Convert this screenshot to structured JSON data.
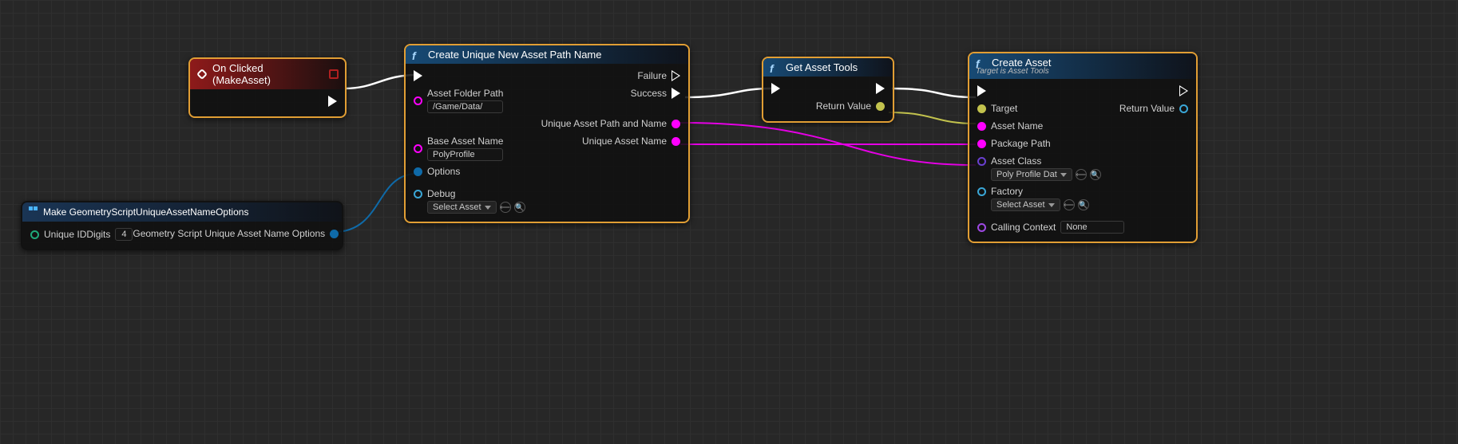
{
  "nodes": {
    "onClicked": {
      "title": "On Clicked (MakeAsset)"
    },
    "makeOpts": {
      "title": "Make GeometryScriptUniqueAssetNameOptions",
      "inputs": {
        "uniqueIdDigits_label": "Unique IDDigits",
        "uniqueIdDigits_value": "4"
      },
      "outputs": {
        "result": "Geometry Script Unique Asset Name Options"
      }
    },
    "createUnique": {
      "title": "Create Unique New Asset Path Name",
      "inputs": {
        "assetFolderPath_label": "Asset Folder Path",
        "assetFolderPath_value": "/Game/Data/",
        "baseAssetName_label": "Base Asset Name",
        "baseAssetName_value": "PolyProfile",
        "options_label": "Options",
        "debug_label": "Debug",
        "debug_value": "Select Asset"
      },
      "outputs": {
        "failure": "Failure",
        "success": "Success",
        "uniquePathName": "Unique Asset Path and Name",
        "uniqueName": "Unique Asset Name"
      }
    },
    "getAssetTools": {
      "title": "Get Asset Tools",
      "outputs": {
        "returnValue": "Return Value"
      }
    },
    "createAsset": {
      "title": "Create Asset",
      "subtitle": "Target is Asset Tools",
      "inputs": {
        "target": "Target",
        "assetName": "Asset Name",
        "packagePath": "Package Path",
        "assetClass_label": "Asset Class",
        "assetClass_value": "Poly Profile Dat",
        "factory_label": "Factory",
        "factory_value": "Select Asset",
        "callingContext_label": "Calling Context",
        "callingContext_value": "None"
      },
      "outputs": {
        "returnValue": "Return Value"
      }
    }
  }
}
